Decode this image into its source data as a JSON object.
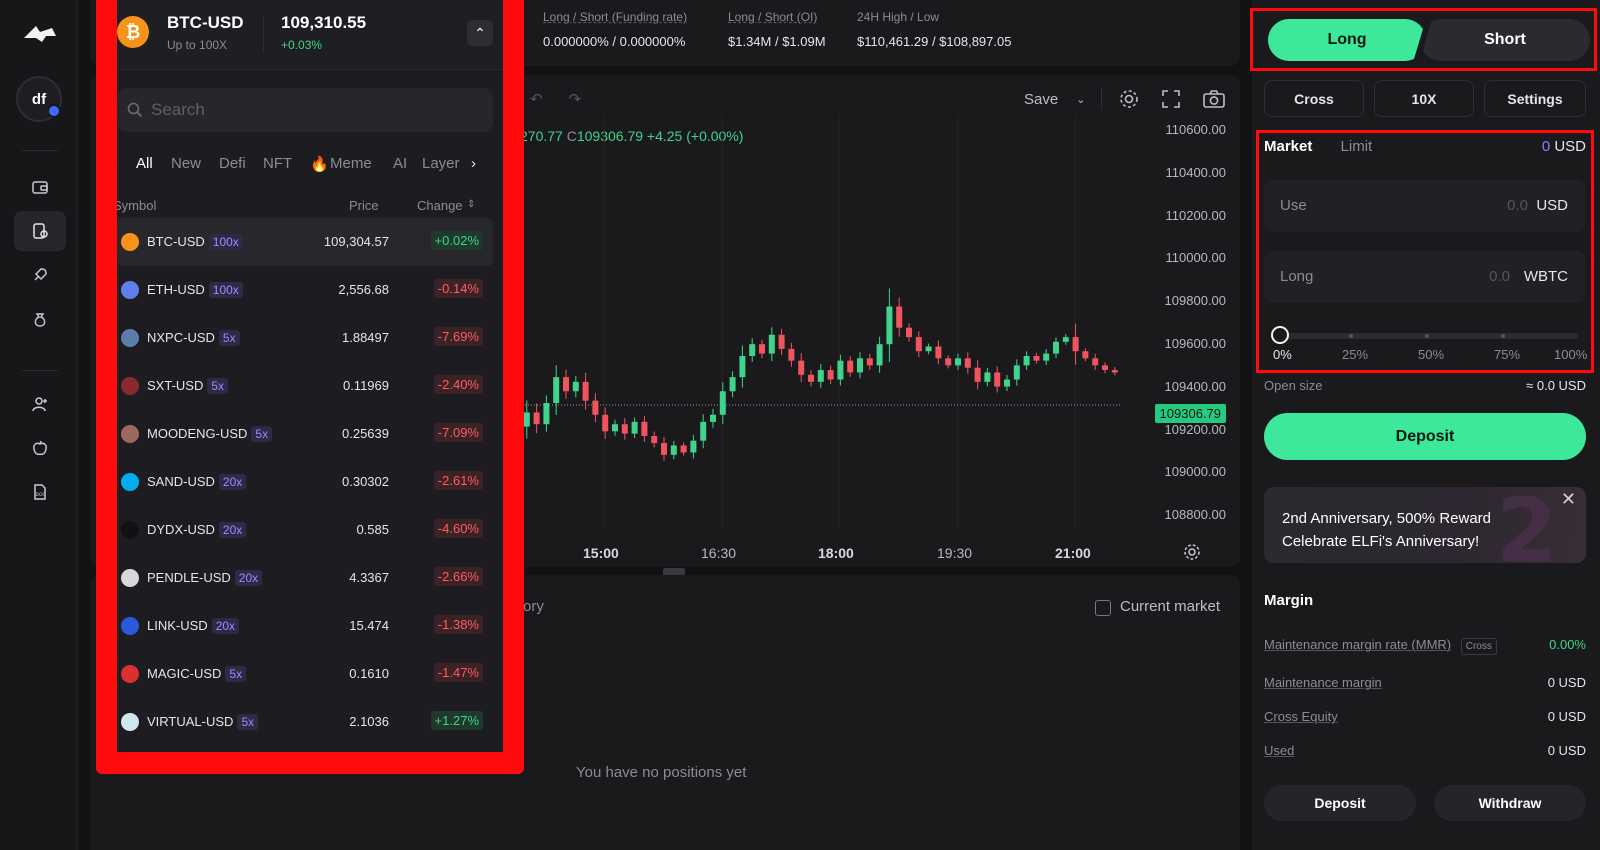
{
  "market": {
    "symbol": "BTC-USD",
    "leverage_note": "Up to 100X",
    "price": "109,310.55",
    "change": "+0.03%"
  },
  "stats": [
    {
      "label": "Long / Short (Funding rate)",
      "value": "0.000000% / 0.000000%"
    },
    {
      "label": "Long / Short (OI)",
      "value": "$1.34M / $1.09M"
    },
    {
      "label": "24H High / Low",
      "value": "$110,461.29 / $108,897.05"
    }
  ],
  "search": {
    "placeholder": "Search"
  },
  "categories": [
    "All",
    "New",
    "Defi",
    "NFT",
    "Meme",
    "AI",
    "Layer"
  ],
  "columns": {
    "symbol": "Symbol",
    "price": "Price",
    "change": "Change"
  },
  "rows": [
    {
      "symbol": "BTC-USD",
      "lev": "100x",
      "price": "109,304.57",
      "change": "+0.02%",
      "dir": "pos",
      "color": "#f7931a"
    },
    {
      "symbol": "ETH-USD",
      "lev": "100x",
      "price": "2,556.68",
      "change": "-0.14%",
      "dir": "neg",
      "color": "#627eea"
    },
    {
      "symbol": "NXPC-USD",
      "lev": "5x",
      "price": "1.88497",
      "change": "-7.69%",
      "dir": "neg",
      "color": "#5b7fa8"
    },
    {
      "symbol": "SXT-USD",
      "lev": "5x",
      "price": "0.11969",
      "change": "-2.40%",
      "dir": "neg",
      "color": "#8a2a2a"
    },
    {
      "symbol": "MOODENG-USD",
      "lev": "5x",
      "price": "0.25639",
      "change": "-7.09%",
      "dir": "neg",
      "color": "#9a6a5a"
    },
    {
      "symbol": "SAND-USD",
      "lev": "20x",
      "price": "0.30302",
      "change": "-2.61%",
      "dir": "neg",
      "color": "#00adef"
    },
    {
      "symbol": "DYDX-USD",
      "lev": "20x",
      "price": "0.585",
      "change": "-4.60%",
      "dir": "neg",
      "color": "#111111"
    },
    {
      "symbol": "PENDLE-USD",
      "lev": "20x",
      "price": "4.3367",
      "change": "-2.66%",
      "dir": "neg",
      "color": "#d8d8d8"
    },
    {
      "symbol": "LINK-USD",
      "lev": "20x",
      "price": "15.474",
      "change": "-1.38%",
      "dir": "neg",
      "color": "#2a5ada"
    },
    {
      "symbol": "MAGIC-USD",
      "lev": "5x",
      "price": "0.1610",
      "change": "-1.47%",
      "dir": "neg",
      "color": "#dc2f2f"
    },
    {
      "symbol": "VIRTUAL-USD",
      "lev": "5x",
      "price": "2.1036",
      "change": "+1.27%",
      "dir": "pos",
      "color": "#cfe8ef"
    }
  ],
  "chart": {
    "save_label": "Save",
    "ohlc_prefix": "270.77",
    "ohlc_c_label": "C",
    "ohlc_close": "109306.79 +4.25 (+0.00%)",
    "last_price": "109306.79",
    "y_ticks": [
      "110600.00",
      "110400.00",
      "110200.00",
      "110000.00",
      "109800.00",
      "109600.00",
      "109400.00",
      "109200.00",
      "109000.00",
      "108800.00"
    ],
    "x_ticks": [
      "15:00",
      "16:30",
      "18:00",
      "19:30",
      "21:00"
    ],
    "x_ticks_bold": [
      true,
      false,
      true,
      false,
      true
    ]
  },
  "positions": {
    "history_tab": "ory",
    "current_market_label": "Current market",
    "empty_text": "You have no positions yet"
  },
  "order": {
    "long_label": "Long",
    "short_label": "Short",
    "cross_label": "Cross",
    "leverage_label": "10X",
    "settings_label": "Settings",
    "market_tab": "Market",
    "limit_tab": "Limit",
    "balance_value": "0",
    "balance_unit": "USD",
    "use_label": "Use",
    "use_value": "0.0",
    "use_unit": "USD",
    "long_field_label": "Long",
    "long_value": "0.0",
    "long_unit": "WBTC",
    "slider_ticks": [
      "0%",
      "25%",
      "50%",
      "75%",
      "100%"
    ],
    "slider_percent": 0,
    "open_size_label": "Open size",
    "open_size_value": "≈ 0.0 USD",
    "deposit_label": "Deposit"
  },
  "banner": {
    "line1": "2nd Anniversary, 500% Reward",
    "line2": "Celebrate ELFi's Anniversary!",
    "numeral": "2"
  },
  "margin": {
    "title": "Margin",
    "rows": [
      {
        "label": "Maintenance margin rate (MMR)",
        "tag": "Cross",
        "value": "0.00%"
      },
      {
        "label": "Maintenance margin",
        "value": "0 USD"
      },
      {
        "label": "Cross Equity",
        "value": "0 USD"
      },
      {
        "label": "Used",
        "value": "0 USD"
      }
    ],
    "deposit_label": "Deposit",
    "withdraw_label": "Withdraw"
  },
  "rail": {
    "avatar_initials": "df"
  },
  "colors": {
    "accent_green": "#3ee89a",
    "up": "#3fd38c",
    "down": "#ff5d5d",
    "annotation": "#ff0b0b"
  }
}
